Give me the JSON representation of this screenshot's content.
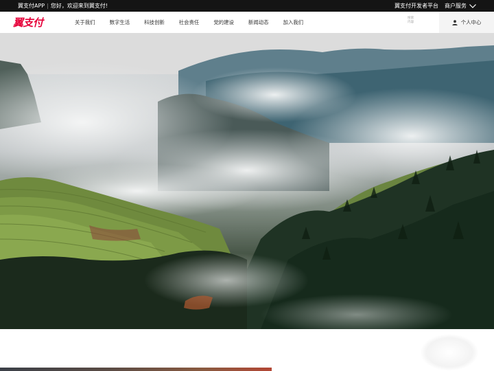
{
  "topbar": {
    "app_label": "翼支付APP",
    "greeting": "您好，欢迎来到翼支付!",
    "developer_platform": "翼支付开发者平台",
    "merchant_service": "商户服务"
  },
  "header": {
    "logo_text": "翼支付",
    "nav": [
      {
        "label": "关于我们"
      },
      {
        "label": "数字生活"
      },
      {
        "label": "科技创新"
      },
      {
        "label": "社会责任"
      },
      {
        "label": "党的建设"
      },
      {
        "label": "新闻动态"
      },
      {
        "label": "加入我们"
      }
    ],
    "search_placeholder_line1": "搜索",
    "search_placeholder_line2": "内容",
    "user_center": "个人中心"
  },
  "colors": {
    "brand_red": "#e60039",
    "topbar_bg": "#141414",
    "user_bg": "#f4f4f4"
  },
  "icons": {
    "merchant": "chevron-down-icon",
    "user": "user-icon"
  }
}
